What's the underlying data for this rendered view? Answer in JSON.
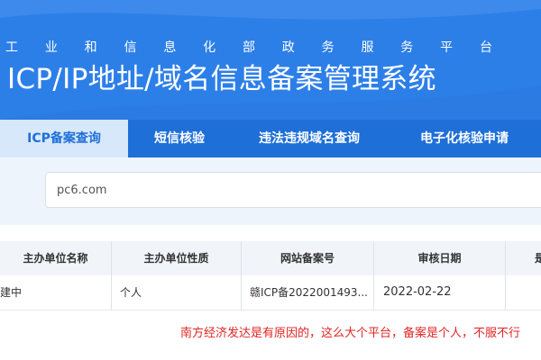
{
  "header": {
    "ministry_chars": [
      "工",
      "业",
      "和",
      "信",
      "息",
      "化",
      "部",
      "政",
      "务",
      "服",
      "务",
      "平",
      "台"
    ],
    "system_title": "ICP/IP地址/域名信息备案管理系统"
  },
  "nav": {
    "tabs": [
      {
        "label": "ICP备案查询",
        "active": true
      },
      {
        "label": "短信核验",
        "active": false
      },
      {
        "label": "违法违规域名查询",
        "active": false
      },
      {
        "label": "电子化核验申请",
        "active": false
      }
    ]
  },
  "search": {
    "value": "pc6.com"
  },
  "table": {
    "headers": [
      "主办单位名称",
      "主办单位性质",
      "网站备案号",
      "审核日期",
      "是"
    ],
    "rows": [
      [
        "建中",
        "个人",
        "赣ICP备2022001493...",
        "2022-02-22",
        ""
      ]
    ]
  },
  "annotation": "南方经济发达是有原因的，这么大个平台，备案是个人，不服不行",
  "colors": {
    "header_blue": "#2d7fe8",
    "nav_blue": "#1e6fd8",
    "active_tab_bg": "#d7e8fb",
    "search_area_bg": "#edf4fc",
    "annotation_red": "#e02424"
  }
}
